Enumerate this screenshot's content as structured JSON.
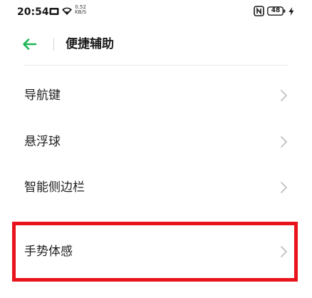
{
  "status_bar": {
    "time": "20:54",
    "speed_value": "0.52",
    "speed_unit": "KB/S",
    "battery": "48",
    "icons": [
      "sim-icon",
      "wifi-icon",
      "nfc-icon",
      "battery-icon",
      "charging-icon"
    ]
  },
  "header": {
    "title": "便捷辅助",
    "back_icon": "arrow-left-icon"
  },
  "menu": {
    "items": [
      {
        "label": "导航键"
      },
      {
        "label": "悬浮球"
      },
      {
        "label": "智能侧边栏"
      },
      {
        "label": "手势体感"
      }
    ]
  },
  "colors": {
    "accent": "#1db554",
    "highlight": "#e8131b",
    "chevron": "#bdbdbd"
  }
}
